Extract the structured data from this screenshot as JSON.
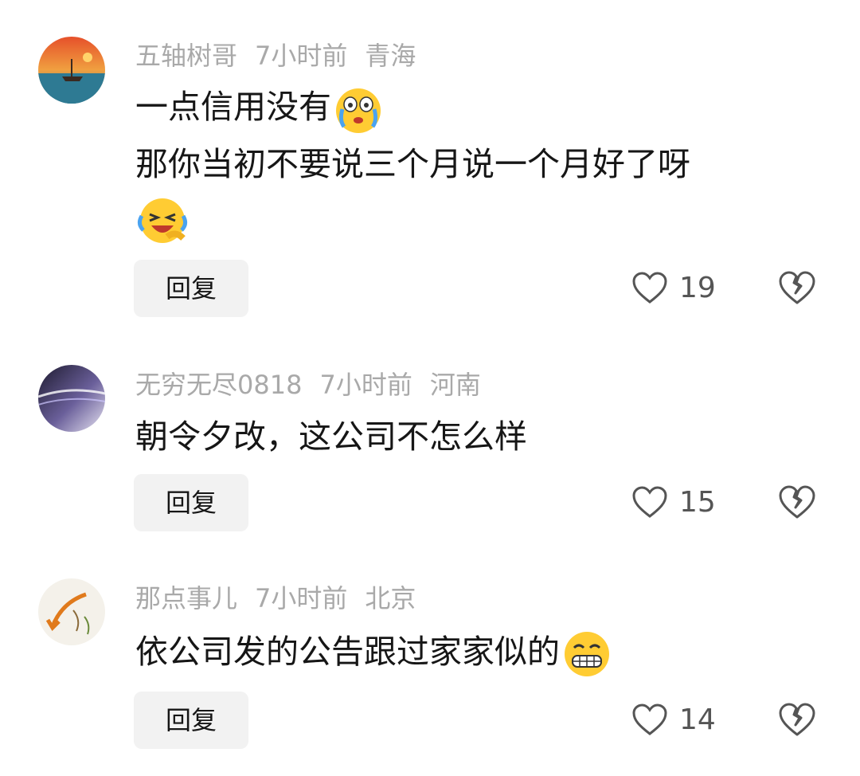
{
  "comments": [
    {
      "username": "五轴树哥",
      "time": "7小时前",
      "location": "青海",
      "lines": [
        "一点信用没有",
        "那你当初不要说三个月说一个月好了呀"
      ],
      "emojis": [
        "crying-emoji",
        "laughing-tears-emoji"
      ],
      "reply_label": "回复",
      "likes": "19",
      "avatar": "sunset-boat-painting-avatar"
    },
    {
      "username": "无穷无尽0818",
      "time": "7小时前",
      "location": "河南",
      "lines": [
        "朝令夕改，这公司不怎么样"
      ],
      "reply_label": "回复",
      "likes": "15",
      "avatar": "abstract-gradient-avatar"
    },
    {
      "username": "那点事儿",
      "time": "7小时前",
      "location": "北京",
      "lines": [
        "依公司发的公告跟过家家似的"
      ],
      "emojis": [
        "grinning-emoji"
      ],
      "reply_label": "回复",
      "likes": "14",
      "avatar": "arrow-sketch-avatar"
    }
  ],
  "colors": {
    "meta_text": "#a9a9a9",
    "body_text": "#161616",
    "reply_bg": "#f2f2f2",
    "icon": "#555555"
  }
}
